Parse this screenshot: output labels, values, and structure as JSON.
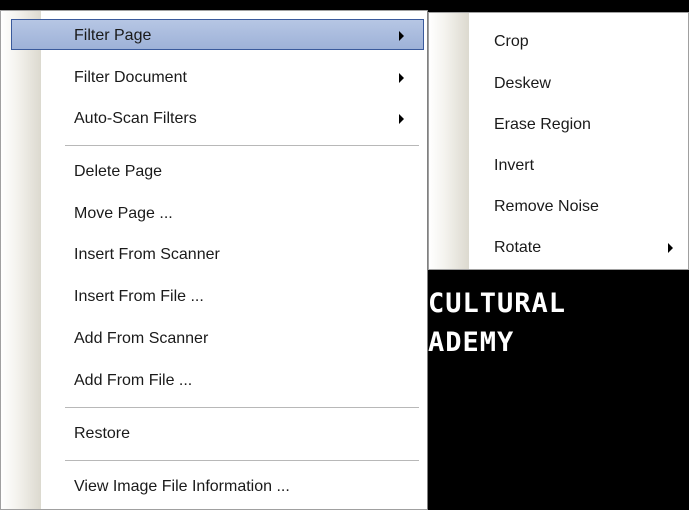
{
  "background_image": {
    "line1": "CULTURAL",
    "line2": "ADEMY"
  },
  "main_menu": {
    "items": [
      {
        "label": "Filter Page",
        "submenu": true
      },
      {
        "label": "Filter Document",
        "submenu": true
      },
      {
        "label": "Auto-Scan Filters",
        "submenu": true
      },
      {
        "label": "Delete Page"
      },
      {
        "label": "Move Page ..."
      },
      {
        "label": "Insert From Scanner"
      },
      {
        "label": "Insert From File ..."
      },
      {
        "label": "Add From Scanner"
      },
      {
        "label": "Add From File ..."
      },
      {
        "label": "Restore"
      },
      {
        "label": "View Image File Information ..."
      }
    ],
    "highlighted_item": "Filter Page"
  },
  "submenu": {
    "parent": "Filter Page",
    "items": [
      {
        "label": "Crop"
      },
      {
        "label": "Deskew"
      },
      {
        "label": "Erase Region"
      },
      {
        "label": "Invert"
      },
      {
        "label": "Remove Noise"
      },
      {
        "label": "Rotate",
        "submenu": true
      }
    ]
  },
  "colors": {
    "highlight": "#b6c6e4",
    "highlight_border": "#3a5a9c",
    "menu_bg": "#ffffff",
    "background": "#000000"
  }
}
